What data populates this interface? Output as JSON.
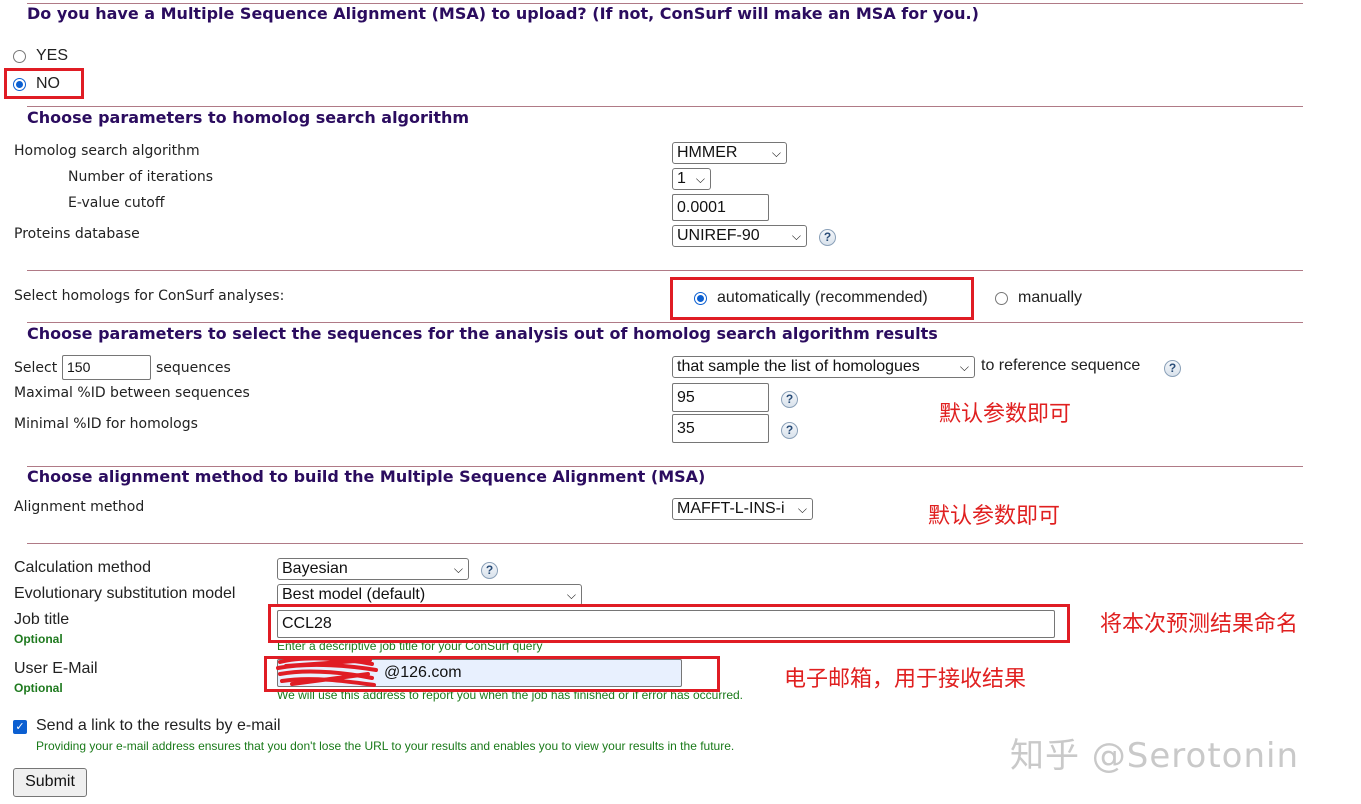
{
  "msa": {
    "title": "Do you have a Multiple Sequence Alignment (MSA) to upload? (If not, ConSurf will make an MSA for you.)",
    "yes_label": "YES",
    "no_label": "NO",
    "selected": "NO"
  },
  "homolog_search": {
    "title": "Choose parameters to homolog search algorithm",
    "algorithm_label": "Homolog search algorithm",
    "algorithm_value": "HMMER",
    "iterations_label": "Number of iterations",
    "iterations_value": "1",
    "evalue_label": "E-value cutoff",
    "evalue_value": "0.0001",
    "database_label": "Proteins database",
    "database_value": "UNIREF-90",
    "help_icon": "?"
  },
  "homolog_select": {
    "label": "Select homologs for ConSurf analyses:",
    "auto_label": "automatically (recommended)",
    "manual_label": "manually",
    "selected": "automatically"
  },
  "sequence_params": {
    "title": "Choose parameters to select the sequences for the analysis out of homolog search algorithm results",
    "select_prefix": "Select",
    "select_value": "150",
    "select_suffix": "sequences",
    "sample_value": "that sample the list of homologues",
    "sample_suffix": "to reference sequence",
    "max_id_label": "Maximal %ID between sequences",
    "max_id_value": "95",
    "min_id_label": "Minimal %ID for homologs",
    "min_id_value": "35"
  },
  "alignment": {
    "title": "Choose alignment method to build the Multiple Sequence Alignment (MSA)",
    "method_label": "Alignment method",
    "method_value": "MAFFT-L-INS-i"
  },
  "calculation": {
    "method_label": "Calculation method",
    "method_value": "Bayesian",
    "model_label": "Evolutionary substitution model",
    "model_value": "Best model (default)"
  },
  "job": {
    "title_label": "Job title",
    "optional": "Optional",
    "title_value": "CCL28",
    "title_hint": "Enter a descriptive job title for your ConSurf query",
    "email_label": "User E-Mail",
    "email_value": "@126.com",
    "email_hint": "We will use this address to report you when the job has finished or if error has occurred.",
    "send_link_label": "Send a link to the results by e-mail",
    "send_link_checked": true,
    "send_link_note": "Providing your e-mail address ensures that you don't lose the URL to your results and enables you to view your results in the future.",
    "submit_label": "Submit"
  },
  "annotations": {
    "default_params_1": "默认参数即可",
    "default_params_2": "默认参数即可",
    "name_result": "将本次预测结果命名",
    "email_note": "电子邮箱，用于接收结果"
  },
  "watermark": "知乎 @Serotonin",
  "colors": {
    "section_title": "#2b0c5f",
    "annotation_red": "#e01c24",
    "optional_green": "#1f7a1f",
    "radio_blue": "#0b5fd1"
  }
}
